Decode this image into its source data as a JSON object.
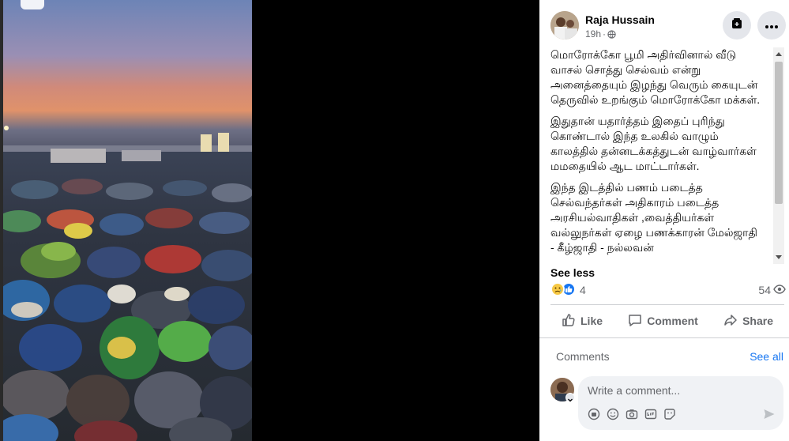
{
  "post": {
    "author": "Raja Hussain",
    "time": "19h",
    "paragraphs": [
      "மொரோக்கோ பூமி அதிர்வினால் வீடு வாசல் சொத்து செல்வம் என்று அனைத்தையும் இழந்து வெரும் கையுடன் தெருவில் உறங்கும் மொரோக்கோ மக்கள்.",
      "இதுதான் யதார்த்தம் இதைப் புரிந்து கொண்டால் இந்த உலகில் வாழும் காலத்தில் தன்னடக்கத்துடன் வாழ்வார்கள் மமதையில் ஆட மாட்டார்கள்.",
      "இந்த இடத்தில் பணம் படைத்த செல்வந்தர்கள் அதிகாரம் படைத்த அரசியல்வாதிகள் ,வைத்தியர்கள் வல்லுநர்கள் ஏழை பணக்காரன் மேல்ஜாதி - கீழ்ஜாதி - நல்லவன்"
    ],
    "see_less": "See less",
    "reaction_count": "4",
    "view_count": "54"
  },
  "actions": {
    "like": "Like",
    "comment": "Comment",
    "share": "Share"
  },
  "comments": {
    "label": "Comments",
    "see_all": "See all",
    "placeholder": "Write a comment..."
  },
  "icons": {
    "save": "save-icon",
    "more": "more-icon",
    "globe": "globe-icon",
    "sad": "sad-reaction-icon",
    "like_reaction": "like-reaction-icon",
    "eye": "eye-icon",
    "thumbs_up": "thumbs-up-icon",
    "comment": "comment-bubble-icon",
    "share": "share-arrow-icon",
    "send": "send-icon"
  },
  "colors": {
    "accent": "#1877f2",
    "secondary_text": "#65676b",
    "primary_text": "#050505"
  }
}
